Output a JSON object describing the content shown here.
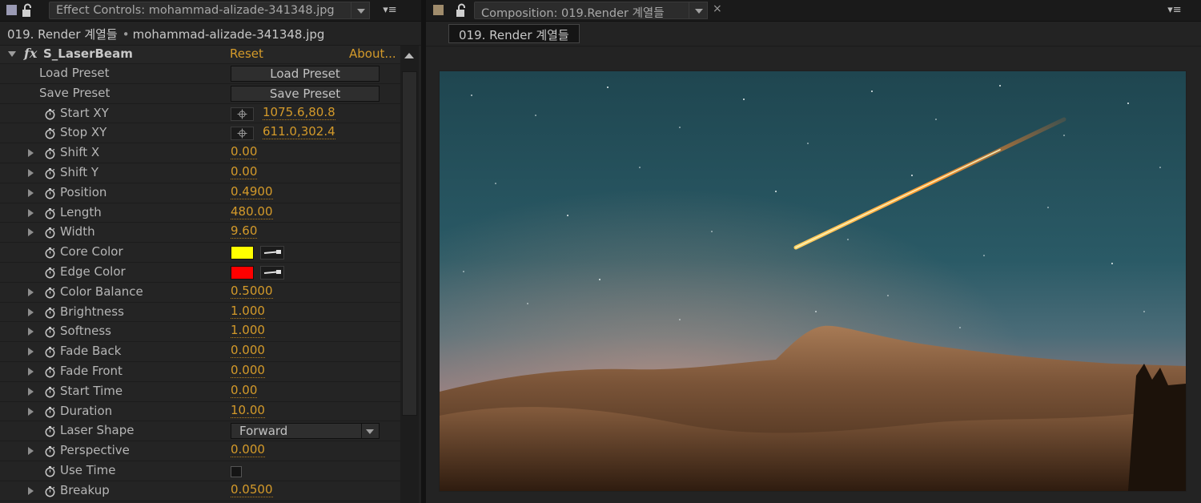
{
  "effect_controls": {
    "tab_label": "Effect Controls: mohammad-alizade-341348.jpg",
    "comp_name": "019. Render 계열들",
    "bullet": "•",
    "layer_name": "mohammad-alizade-341348.jpg",
    "menu_icon": "▾≡"
  },
  "effect": {
    "fx_symbol": "fx",
    "name": "S_LaserBeam",
    "reset_label": "Reset",
    "about_label": "About..."
  },
  "params": [
    {
      "label": "Load Preset",
      "kind": "button",
      "value": "Load Preset"
    },
    {
      "label": "Save Preset",
      "kind": "button",
      "value": "Save Preset"
    },
    {
      "label": "Start XY",
      "kind": "point",
      "value": "1075.6,80.8"
    },
    {
      "label": "Stop XY",
      "kind": "point",
      "value": "611.0,302.4"
    },
    {
      "label": "Shift X",
      "kind": "number",
      "value": "0.00"
    },
    {
      "label": "Shift Y",
      "kind": "number",
      "value": "0.00"
    },
    {
      "label": "Position",
      "kind": "number",
      "value": "0.4900"
    },
    {
      "label": "Length",
      "kind": "number",
      "value": "480.00"
    },
    {
      "label": "Width",
      "kind": "number",
      "value": "9.60"
    },
    {
      "label": "Core Color",
      "kind": "color",
      "color": "#ffff00"
    },
    {
      "label": "Edge Color",
      "kind": "color",
      "color": "#ff0000"
    },
    {
      "label": "Color Balance",
      "kind": "number",
      "value": "0.5000"
    },
    {
      "label": "Brightness",
      "kind": "number",
      "value": "1.000"
    },
    {
      "label": "Softness",
      "kind": "number",
      "value": "1.000"
    },
    {
      "label": "Fade Back",
      "kind": "number",
      "value": "0.000"
    },
    {
      "label": "Fade Front",
      "kind": "number",
      "value": "0.000"
    },
    {
      "label": "Start Time",
      "kind": "number",
      "value": "0.00"
    },
    {
      "label": "Duration",
      "kind": "number",
      "value": "10.00"
    },
    {
      "label": "Laser Shape",
      "kind": "select",
      "value": "Forward"
    },
    {
      "label": "Perspective",
      "kind": "number",
      "value": "0.000"
    },
    {
      "label": "Use Time",
      "kind": "checkbox",
      "checked": false
    },
    {
      "label": "Breakup",
      "kind": "number",
      "value": "0.0500"
    }
  ],
  "composition": {
    "tab_label": "Composition: 019.Render 계열들",
    "close_glyph": "×",
    "viewer_tab": "019. Render 계열들",
    "menu_icon": "▾≡"
  },
  "colors": {
    "accent_value": "#d49a2a",
    "panel_bg": "#232323",
    "effect_tab_swatch": "#9a9ab4",
    "comp_tab_swatch": "#a08c6c"
  }
}
